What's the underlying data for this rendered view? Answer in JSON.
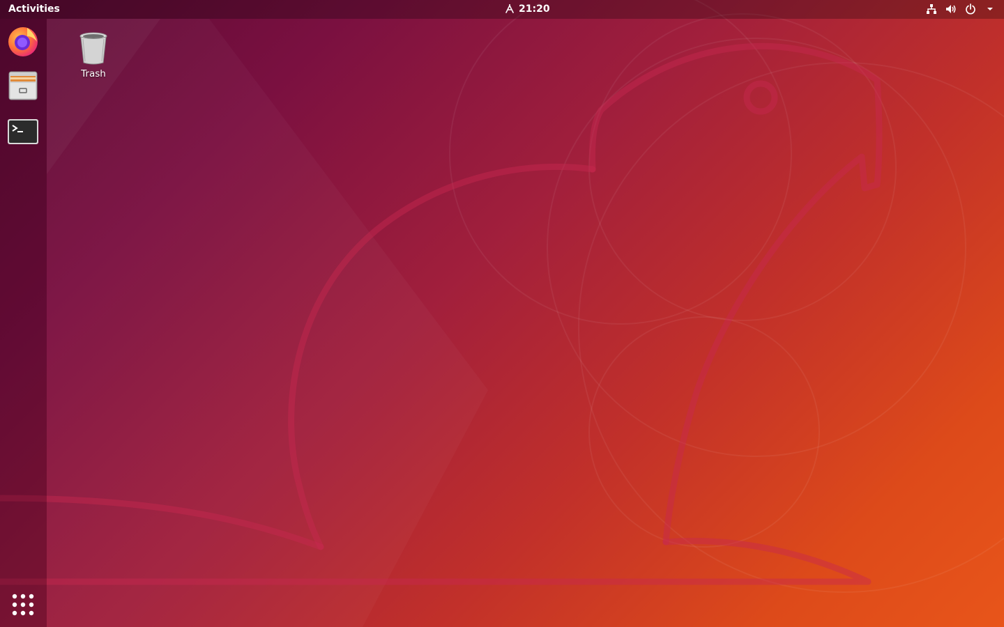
{
  "topbar": {
    "activities_label": "Activities",
    "clock": "21:20",
    "clock_icon": "alarm-icon",
    "tray_icons": [
      "network-icon",
      "volume-icon",
      "power-icon",
      "chevron-down-icon"
    ]
  },
  "dock": {
    "items": [
      {
        "name": "Firefox",
        "icon": "firefox-icon"
      },
      {
        "name": "Files",
        "icon": "files-icon"
      },
      {
        "name": "Terminal",
        "icon": "terminal-icon"
      }
    ],
    "show_apps_icon": "grid-icon"
  },
  "desktop": {
    "icons": [
      {
        "label": "Trash",
        "icon": "trash-icon"
      }
    ]
  },
  "colors": {
    "gradient_dark": "#5a0a34",
    "gradient_mid": "#a11f3c",
    "gradient_light": "#e8551a",
    "topbar_text": "#ffffff"
  }
}
